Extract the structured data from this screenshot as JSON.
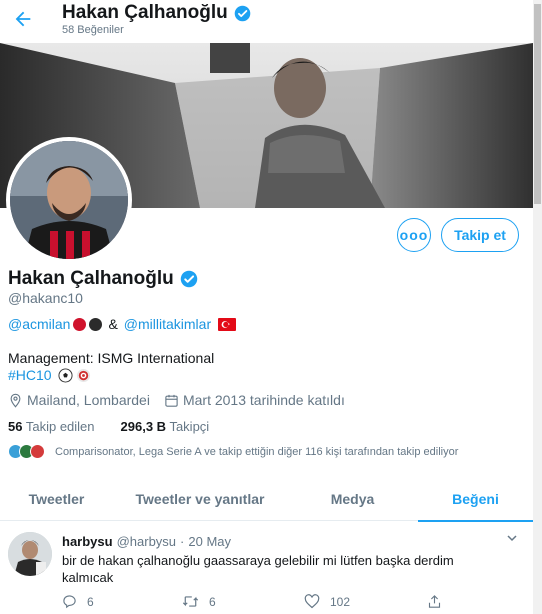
{
  "header": {
    "title": "Hakan Çalhanoğlu",
    "subtitle": "58 Beğeniler"
  },
  "profile": {
    "name": "Hakan Çalhanoğlu",
    "handle": "@hakanc10",
    "follow_label": "Takip et",
    "more_label": "ooo",
    "bio": {
      "line1_link1": "@acmilan",
      "line1_amp": "&",
      "line1_link2": "@millitakimlar",
      "line2": "Management: ISMG International",
      "line3_link": "#HC10"
    },
    "location": "Mailand, Lombardei",
    "joined": "Mart 2013 tarihinde katıldı",
    "following_count": "56",
    "following_label": "Takip edilen",
    "followers_count": "296,3 B",
    "followers_label": "Takipçi",
    "followed_by": "Comparisonator, Lega Serie A ve takip ettiğin diğer 116 kişi tarafından takip ediliyor"
  },
  "tabs": [
    {
      "label": "Tweetler",
      "active": false
    },
    {
      "label": "Tweetler ve yanıtlar",
      "active": false
    },
    {
      "label": "Medya",
      "active": false
    },
    {
      "label": "Beğeni",
      "active": true
    }
  ],
  "tweet": {
    "name": "harbysu",
    "handle": "@harbysu",
    "separator": "·",
    "date": "20 May",
    "text": "bir de hakan çalhanoğlu gaassaraya gelebilir mi lütfen başka derdim kalmıcak",
    "replies": "6",
    "retweets": "6",
    "likes": "102"
  },
  "colors": {
    "accent": "#1da1f2",
    "secondary_text": "#657786",
    "verified": "#1da1f2"
  }
}
